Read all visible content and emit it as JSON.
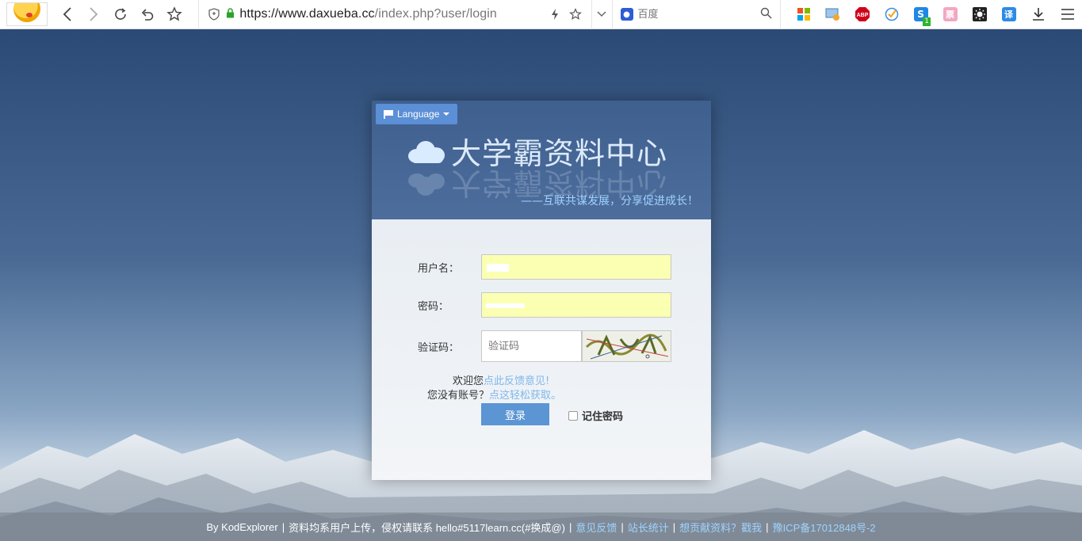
{
  "browser": {
    "url_main": "https://www.daxueba.cc",
    "url_rest": "/index.php?user/login",
    "search_placeholder": "百度",
    "ext_abp_label": "ABP",
    "ext_s_label": "S",
    "ext_s_badge": "1",
    "ext_ticket_label": "票",
    "ext_translate_label": "译"
  },
  "header": {
    "language_label": "Language",
    "site_title": "大学霸资料中心",
    "tagline": "——互联共谋发展，分享促进成长！"
  },
  "form": {
    "username_label": "用户名：",
    "password_label": "密码：",
    "captcha_label": "验证码：",
    "captcha_placeholder": "验证码",
    "welcome_prefix": "欢迎您",
    "feedback_link": "点此反馈意见!",
    "no_account_prefix": "您没有账号？",
    "get_account_link": "点这轻松获取。",
    "login_button": "登录",
    "remember_label": "记住密码"
  },
  "footer": {
    "by_text": "By KodExplorer",
    "notice_text": "资料均系用户上传，侵权请联系 hello#5117learn.cc(#换成@)",
    "feedback_link": "意见反馈",
    "stats_link": "站长统计",
    "contribute_link": "想贡献资料？戳我",
    "icp_link": "豫ICP备17012848号-2"
  },
  "colors": {
    "header_bg": "#4a6a99",
    "accent_button": "#5b95d4",
    "link": "#7fb8ea",
    "autofill": "#fbffb2"
  }
}
